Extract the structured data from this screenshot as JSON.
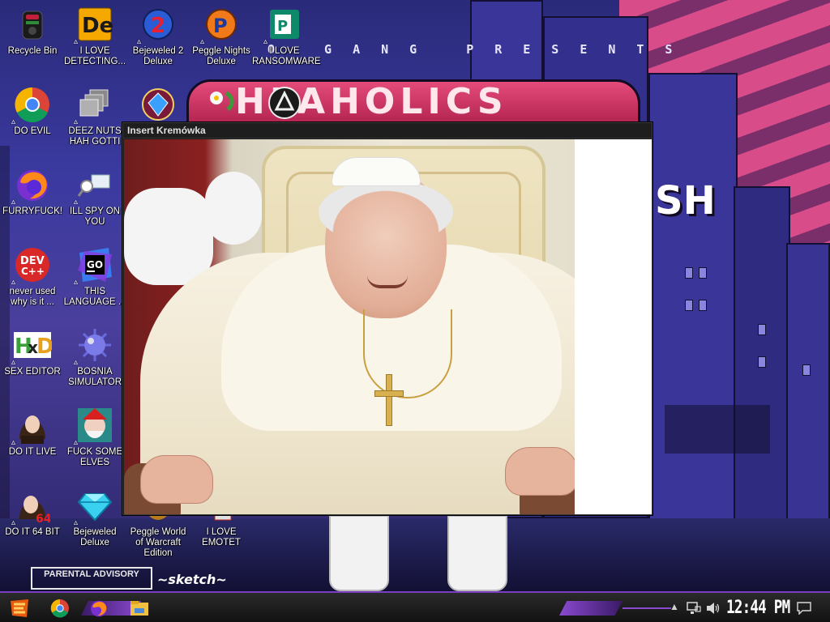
{
  "wallpaper": {
    "band_text": "O GANG PRESENTS",
    "logo_text": "HPAHOLICS",
    "side_text": "SH",
    "advisory_text": "PARENTAL ADVISORY"
  },
  "desktop_icons": [
    {
      "label": "Recycle Bin",
      "icon": "recycle-bin-icon"
    },
    {
      "label": "I LOVE DETECTING...",
      "icon": "detect-it-easy-icon"
    },
    {
      "label": "Bejeweled 2 Deluxe",
      "icon": "bejeweled-2-icon"
    },
    {
      "label": "Peggle Nights Deluxe",
      "icon": "peggle-nights-icon"
    },
    {
      "label": "I LOVE RANSOMWARE",
      "icon": "publisher-icon"
    },
    {
      "label": "DO EVIL",
      "icon": "chrome-icon"
    },
    {
      "label": "DEEZ NUTS HAH GOTTI",
      "icon": "windows-stack-icon"
    },
    {
      "label": "FURRYFUCK!",
      "icon": "firefox-icon"
    },
    {
      "label": "ILL SPY ON YOU",
      "icon": "network-spy-icon"
    },
    {
      "label": "never used why is it ...",
      "icon": "dev-cpp-icon"
    },
    {
      "label": "THIS LANGUAGE ...",
      "icon": "goland-icon"
    },
    {
      "label": "SEX EDITOR",
      "icon": "hxd-icon"
    },
    {
      "label": "BOSNIA SIMULATOR",
      "icon": "minesweeper-icon"
    },
    {
      "label": "DO IT LIVE",
      "icon": "portrait-icon"
    },
    {
      "label": "FUCK SOME ELVES",
      "icon": "elf-icon"
    },
    {
      "label": "DO IT 64 BIT",
      "icon": "portrait-64-icon"
    },
    {
      "label": "Bejeweled Deluxe",
      "icon": "diamond-icon"
    },
    {
      "label": "Peggle World of Warcraft Edition",
      "icon": "peggle-wow-icon"
    },
    {
      "label": "I LOVE EMOTET",
      "icon": "emotet-icon"
    }
  ],
  "window": {
    "title": "Insert Kremówka",
    "content": "photo"
  },
  "taskbar": {
    "pinned": [
      "start-icon",
      "chrome-icon",
      "firefox-icon",
      "file-explorer-icon"
    ],
    "tray": [
      "show-hidden-icons-icon",
      "network-icon",
      "volume-icon",
      "notification-icon"
    ],
    "clock": "12:44 PM"
  },
  "colors": {
    "accent": "#8a4ad0",
    "taskbar": "#1a1a1a",
    "window_title": "#1e1e1e"
  }
}
